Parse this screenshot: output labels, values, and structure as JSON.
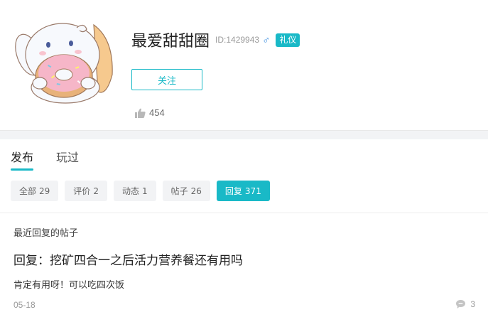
{
  "profile": {
    "username": "最爱甜甜圈",
    "user_id": "ID:1429943",
    "gender_symbol": "♂",
    "badge": "礼仪",
    "follow_label": "关注",
    "likes_count": "454",
    "icons": {
      "avatar": "cinnamoroll-donut-avatar",
      "likes": "thumbs-up-icon",
      "gender": "male-icon"
    }
  },
  "tabs": [
    {
      "label": "发布",
      "active": true
    },
    {
      "label": "玩过",
      "active": false
    }
  ],
  "filters": [
    {
      "label": "全部",
      "count": "29",
      "active": false
    },
    {
      "label": "评价",
      "count": "2",
      "active": false
    },
    {
      "label": "动态",
      "count": "1",
      "active": false
    },
    {
      "label": "帖子",
      "count": "26",
      "active": false
    },
    {
      "label": "回复",
      "count": "371",
      "active": true
    }
  ],
  "section_title": "最近回复的帖子",
  "post": {
    "title": "回复：挖矿四合一之后活力营养餐还有用吗",
    "body": "肯定有用呀！可以吃四次饭",
    "date": "05-18",
    "comment_count": "3"
  },
  "colors": {
    "accent": "#19b9c7",
    "band": "#f2f3f5"
  }
}
